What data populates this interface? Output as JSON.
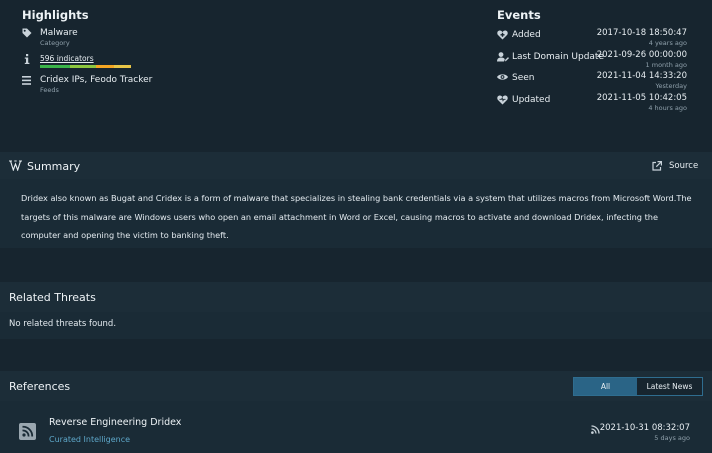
{
  "highlights": {
    "title": "Highlights",
    "malware": {
      "value": "Malware",
      "label": "Category",
      "icon": "tag-icon"
    },
    "indicators": {
      "value": "596 indicators",
      "icon": "info-icon",
      "bar_colors": [
        "#3bb54a",
        "#8dc63f",
        "#f5a623",
        "#e8c547"
      ]
    },
    "feeds": {
      "value": "Cridex IPs, Feodo Tracker",
      "label": "Feeds",
      "icon": "list-icon"
    }
  },
  "events": {
    "title": "Events",
    "items": [
      {
        "label": "Added",
        "date": "2017-10-18 18:50:47",
        "ago": "4 years ago",
        "icon": "heart-plus-icon"
      },
      {
        "label": "Last Domain Update",
        "date": "2021-09-26 00:00:00",
        "ago": "1 month ago",
        "icon": "user-edit-icon"
      },
      {
        "label": "Seen",
        "date": "2021-11-04 14:33:20",
        "ago": "Yesterday",
        "icon": "eye-icon"
      },
      {
        "label": "Updated",
        "date": "2021-11-05 10:42:05",
        "ago": "4 hours ago",
        "icon": "heart-icon"
      }
    ]
  },
  "summary": {
    "title": "Summary",
    "source_label": "Source",
    "text": "Dridex also known as Bugat and Cridex is a form of malware that specializes in stealing bank credentials via a system that utilizes macros from Microsoft Word.The targets of this malware are Windows users who open an email attachment in Word or Excel, causing macros to activate and download Dridex, infecting the computer and opening the victim to banking theft."
  },
  "related_threats": {
    "title": "Related Threats",
    "empty_text": "No related threats found."
  },
  "references": {
    "title": "References",
    "tabs": [
      {
        "label": "All",
        "active": true
      },
      {
        "label": "Latest News",
        "active": false
      }
    ],
    "items": [
      {
        "title": "Reverse Engineering Dridex",
        "source": "Curated Intelligence",
        "date": "2021-10-31 08:32:07",
        "ago": "5 days ago",
        "icon": "rss-icon"
      }
    ]
  }
}
